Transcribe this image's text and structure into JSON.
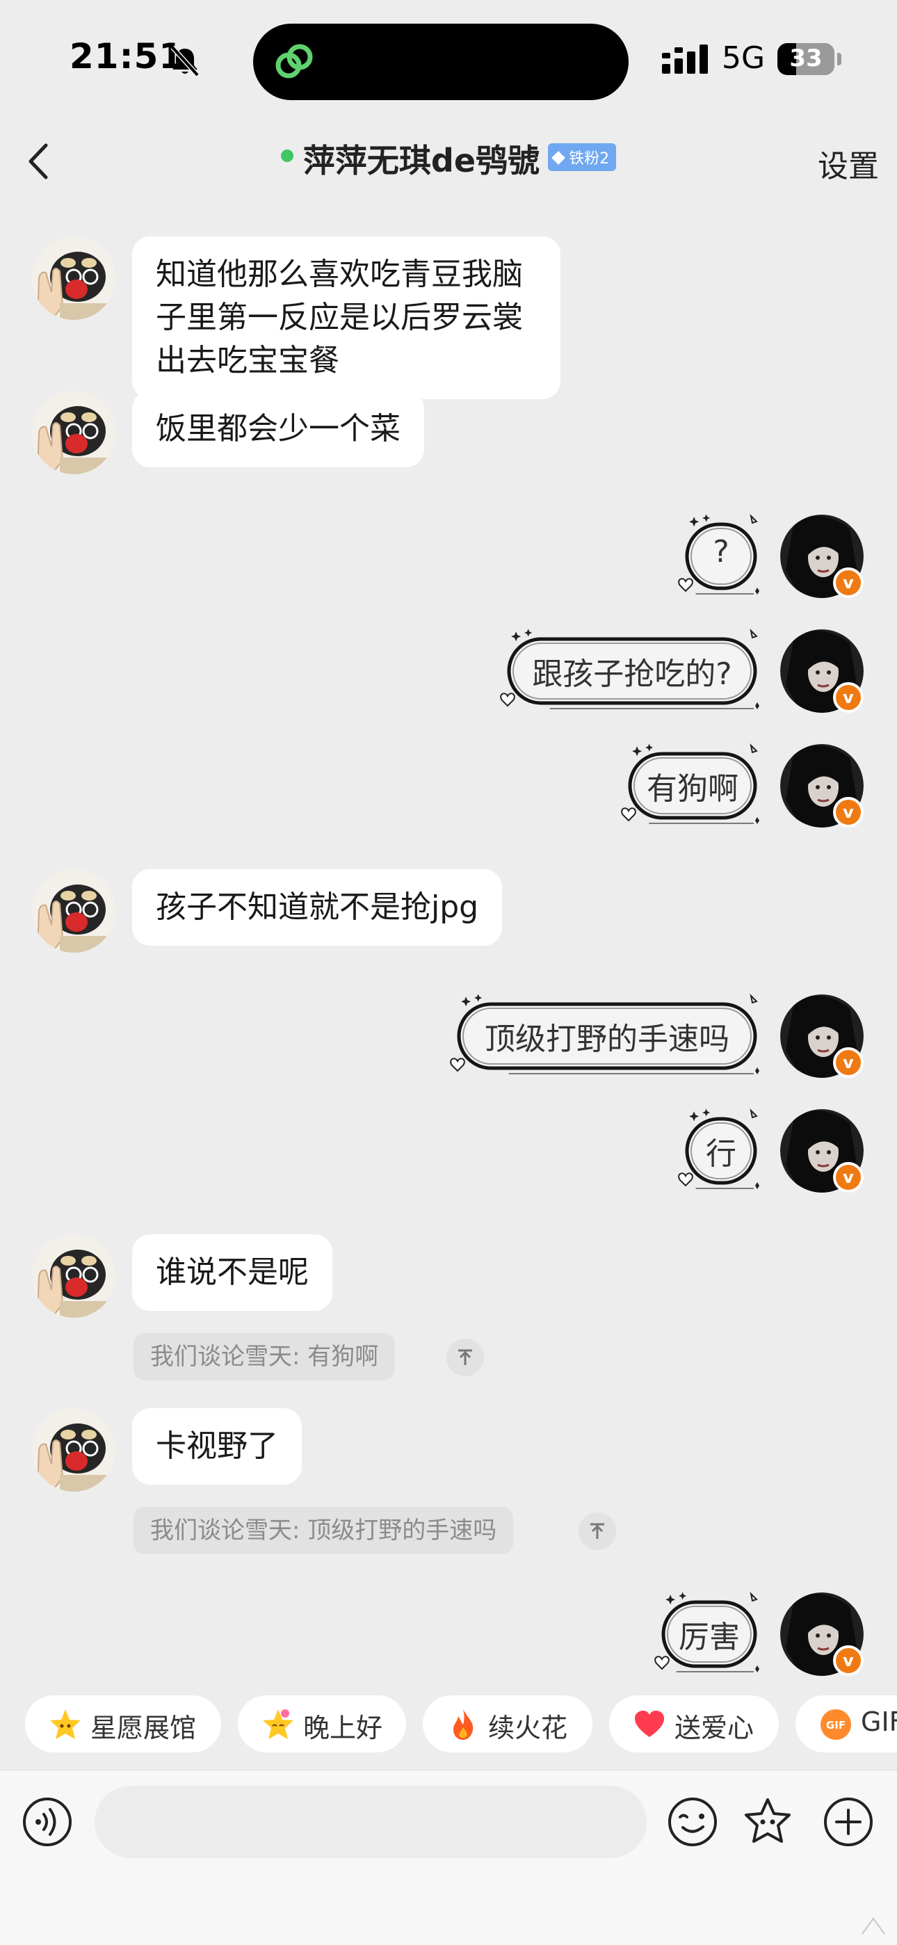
{
  "status_bar": {
    "time": "21:51",
    "network": "5G",
    "battery": "33",
    "battery_level": 0.33
  },
  "nav": {
    "title": "萍萍无琪de鸮號",
    "badge": "铁粉2",
    "settings": "设置"
  },
  "messages": [
    {
      "side": "left",
      "text": "知道他那么喜欢吃青豆我脑子里第一反应是以后罗云裳出去吃宝宝餐"
    },
    {
      "side": "left",
      "text": "饭里都会少一个菜"
    },
    {
      "side": "right",
      "text": "?"
    },
    {
      "side": "right",
      "text": "跟孩子抢吃的?"
    },
    {
      "side": "right",
      "text": "有狗啊"
    },
    {
      "side": "left",
      "text": "孩子不知道就不是抢jpg"
    },
    {
      "side": "right",
      "text": "顶级打野的手速吗"
    },
    {
      "side": "right",
      "text": "行"
    },
    {
      "side": "left",
      "text": "谁说不是呢",
      "quote": "我们谈论雪天: 有狗啊"
    },
    {
      "side": "left",
      "text": "卡视野了",
      "quote": "我们谈论雪天: 顶级打野的手速吗"
    },
    {
      "side": "right",
      "text": "厉害"
    }
  ],
  "quick_replies": [
    {
      "label": "星愿展馆",
      "icon": "star-face-icon"
    },
    {
      "label": "晚上好",
      "icon": "star-face-icon"
    },
    {
      "label": "续火花",
      "icon": "fire-icon"
    },
    {
      "label": "送爱心",
      "icon": "heart-icon"
    },
    {
      "label": "GIF",
      "icon": "gif-icon"
    }
  ],
  "input": {
    "placeholder": ""
  },
  "colors": {
    "background": "#ededed",
    "bubble_left": "#ffffff",
    "online": "#3fc765",
    "badge": "#6fa8f0",
    "vip": "#f07a12"
  }
}
